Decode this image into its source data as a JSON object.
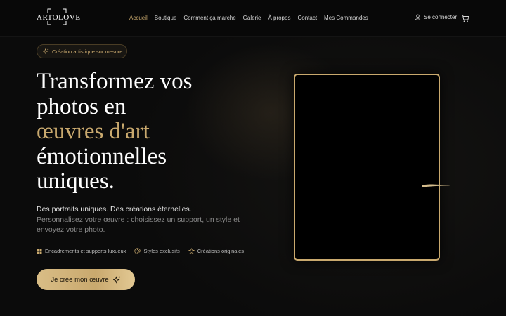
{
  "header": {
    "logo_text": "ARTOLOVE",
    "nav": [
      {
        "label": "Accueil",
        "active": true
      },
      {
        "label": "Boutique",
        "active": false
      },
      {
        "label": "Comment ça marche",
        "active": false
      },
      {
        "label": "Galerie",
        "active": false
      },
      {
        "label": "À propos",
        "active": false
      },
      {
        "label": "Contact",
        "active": false
      },
      {
        "label": "Mes Commandes",
        "active": false
      }
    ],
    "login_label": "Se connecter",
    "login_icon": "user-icon",
    "cart_icon": "cart-icon"
  },
  "hero": {
    "badge": {
      "icon": "sparkles-icon",
      "label": "Création artistique sur mesure"
    },
    "headline_line1": "Transformez vos",
    "headline_line2": "photos en",
    "headline_highlight": "œuvres d'art",
    "headline_line4": "émotionnelles",
    "headline_line5": "uniques.",
    "subtitle": "Des portraits uniques. Des créations éternelles.",
    "description": "Personnalisez votre œuvre : choisissez un support, un style et envoyez votre photo.",
    "features": [
      {
        "icon": "grid-icon",
        "label": "Encadrements et supports luxueux"
      },
      {
        "icon": "palette-icon",
        "label": "Styles exclusifs"
      },
      {
        "icon": "star-icon",
        "label": "Créations originales"
      }
    ],
    "cta": {
      "label": "Je crée mon œuvre",
      "icon": "sparkles-icon"
    }
  },
  "colors": {
    "accent": "#c9a96e",
    "background": "#0c0c0c",
    "text": "#ffffff",
    "muted": "#8a8a8a"
  }
}
